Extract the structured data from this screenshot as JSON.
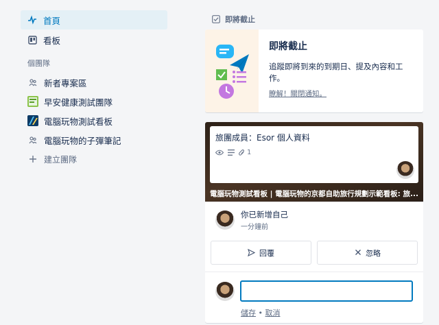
{
  "sidebar": {
    "nav": [
      {
        "label": "首頁",
        "icon": "activity-icon",
        "active": true
      },
      {
        "label": "看板",
        "icon": "board-icon",
        "active": false
      }
    ],
    "section_title": "個團隊",
    "teams": [
      {
        "label": "新者專案區",
        "icon": "team-icon"
      },
      {
        "label": "早安健康測試團隊",
        "icon": "team-logo-image"
      },
      {
        "label": "電腦玩物測試看板",
        "icon": "team-logo-image"
      },
      {
        "label": "電腦玩物的子彈筆記",
        "icon": "team-icon"
      }
    ],
    "create_team": "建立團隊"
  },
  "main": {
    "heading": "即將截止",
    "promo": {
      "title": "即將截止",
      "text": "追蹤即將到來的到期日、提及內容和工作。",
      "link": "瞭解！關閉通知。"
    },
    "board_card": {
      "card_title": "旅團成員：Esor 個人資料",
      "attachments_count": "1",
      "board_name": "電腦玩物測試看板 | 電腦玩物的京都自助旅行規劃示範看板: 旅..."
    },
    "activity": {
      "text": "你已新增自己",
      "time": "一分鐘前"
    },
    "actions": {
      "reply": "回覆",
      "dismiss": "忽略"
    },
    "comment": {
      "value": "",
      "placeholder": "",
      "save": "儲存",
      "separator": " • ",
      "cancel": "取消"
    }
  }
}
